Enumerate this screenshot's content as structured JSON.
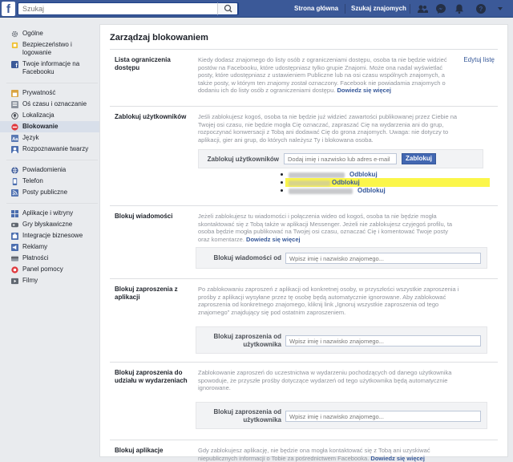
{
  "topbar": {
    "logo": "f",
    "search_placeholder": "Szukaj",
    "home": "Strona główna",
    "find_friends": "Szukaj znajomych"
  },
  "sidebar": {
    "groups": [
      [
        {
          "label": "Ogólne",
          "icon": "gear-icon"
        },
        {
          "label": "Bezpieczeństwo i logowanie",
          "icon": "shield-icon"
        },
        {
          "label": "Twoje informacje na Facebooku",
          "icon": "facebook-icon"
        }
      ],
      [
        {
          "label": "Prywatność",
          "icon": "lock-icon"
        },
        {
          "label": "Oś czasu i oznaczanie",
          "icon": "timeline-icon"
        },
        {
          "label": "Lokalizacja",
          "icon": "location-icon"
        },
        {
          "label": "Blokowanie",
          "icon": "block-icon",
          "active": true
        },
        {
          "label": "Język",
          "icon": "language-icon"
        },
        {
          "label": "Rozpoznawanie twarzy",
          "icon": "face-icon"
        }
      ],
      [
        {
          "label": "Powiadomienia",
          "icon": "globe-icon"
        },
        {
          "label": "Telefon",
          "icon": "phone-icon"
        },
        {
          "label": "Posty publiczne",
          "icon": "rss-icon"
        }
      ],
      [
        {
          "label": "Aplikacje i witryny",
          "icon": "apps-icon"
        },
        {
          "label": "Gry błyskawiczne",
          "icon": "game-icon"
        },
        {
          "label": "Integracje biznesowe",
          "icon": "business-icon"
        },
        {
          "label": "Reklamy",
          "icon": "ads-icon"
        },
        {
          "label": "Płatności",
          "icon": "payments-icon"
        },
        {
          "label": "Panel pomocy",
          "icon": "help-icon"
        },
        {
          "label": "Filmy",
          "icon": "video-icon"
        }
      ]
    ]
  },
  "main": {
    "title": "Zarządzaj blokowaniem",
    "restricted": {
      "label": "Lista ograniczenia dostępu",
      "desc": "Kiedy dodasz znajomego do listy osób z ograniczeniami dostępu, osoba ta nie będzie widzieć postów na Facebooku, które udostępniasz tylko grupie Znajomi. Może ona nadal wyświetlać posty, które udostępniasz z ustawieniem Publiczne lub na osi czasu wspólnych znajomych, a także posty, w którym ten znajomy został oznaczony. Facebook nie powiadamia znajomych o dodaniu ich do listy osób z ograniczeniami dostępu.",
      "more": "Dowiedz się więcej",
      "edit": "Edytuj listę"
    },
    "block_users": {
      "label": "Zablokuj użytkowników",
      "desc": "Jeśli zablokujesz kogoś, osoba ta nie będzie już widzieć zawartości publikowanej przez Ciebie na Twojej osi czasu, nie będzie mogła Cię oznaczać, zapraszać Cię na wydarzenia ani do grup, rozpoczynać konwersacji z Tobą ani dodawać Cię do grona znajomych. Uwaga: nie dotyczy to aplikacji, gier ani grup, do których należysz Ty i blokowana osoba.",
      "form_label": "Zablokuj użytkowników",
      "placeholder": "Dodaj imię i nazwisko lub adres e-mail",
      "button": "Zablokuj",
      "unblock": "Odblokuj"
    },
    "block_messages": {
      "label": "Blokuj wiadomości",
      "desc": "Jeżeli zablokujesz tu wiadomości i połączenia wideo od kogoś, osoba ta nie będzie mogła skontaktować się z Tobą także w aplikacji Messenger. Jeżeli nie zablokujesz czyjegoś profilu, ta osoba będzie mogła publikować na Twojej osi czasu, oznaczać Cię i komentować Twoje posty oraz komentarze.",
      "more": "Dowiedz się więcej",
      "form_label": "Blokuj wiadomości od",
      "placeholder": "Wpisz imię i nazwisko znajomego..."
    },
    "block_app_invites": {
      "label": "Blokuj zaproszenia z aplikacji",
      "desc": "Po zablokowaniu zaproszeń z aplikacji od konkretnej osoby, w przyszłości wszystkie zaproszenia i prośby z aplikacji wysyłane przez tę osobę będą automatycznie ignorowane. Aby zablokować zaproszenia od konkretnego znajomego, kliknij link „Ignoruj wszystkie zaproszenia od tego znajomego” znajdujący się pod ostatnim zaproszeniem.",
      "form_label": "Blokuj zaproszenia od użytkownika",
      "placeholder": "Wpisz imię i nazwisko znajomego..."
    },
    "block_event_invites": {
      "label": "Blokuj zaproszenia do udziału w wydarzeniach",
      "desc": "Zablokowanie zaproszeń do uczestnictwa w wydarzeniu pochodzących od danego użytkownika spowoduje, że przyszłe prośby dotyczące wydarzeń od tego użytkownika będą automatycznie ignorowane.",
      "form_label": "Blokuj zaproszenia od użytkownika",
      "placeholder": "Wpisz imię i nazwisko znajomego..."
    },
    "block_apps": {
      "label": "Blokuj aplikacje",
      "desc": "Gdy zablokujesz aplikację, nie będzie ona mogła kontaktować się z Tobą ani uzyskiwać niepublicznych informacji o Tobie za pośrednictwem Facebooka.",
      "more": "Dowiedz się więcej"
    }
  }
}
